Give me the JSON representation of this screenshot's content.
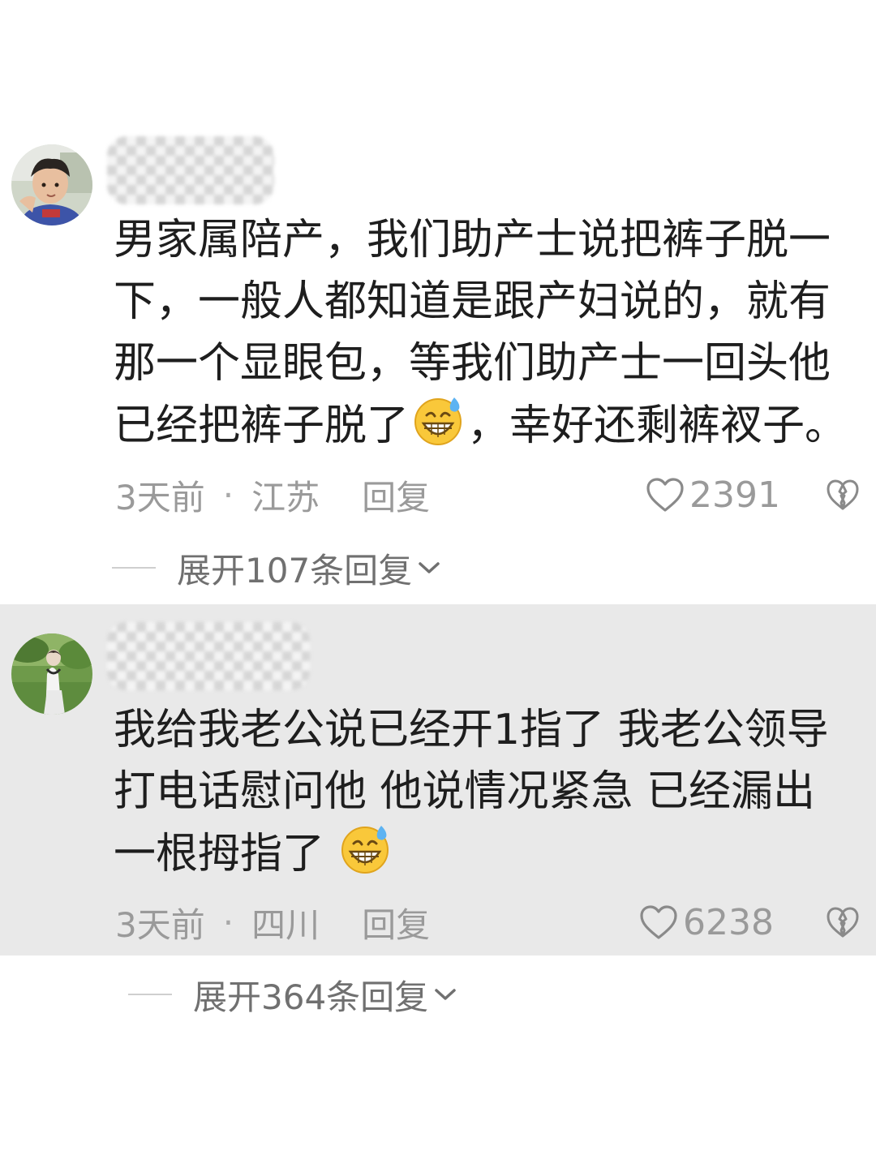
{
  "comments": [
    {
      "lines": [
        "男家属陪产，我们助产士说把裤子脱一",
        "下，一般人都知道是跟产妇说的，就有",
        "那一个显眼包，等我们助产士一回头他"
      ],
      "last_line_before_emoji": "已经把裤子脱了",
      "last_line_after_emoji": "，幸好还剩裤衩子。",
      "emoji_icon": "grinning-sweat-emoji",
      "time": "3天前",
      "separator": "·",
      "location": "江苏",
      "reply_label": "回复",
      "likes": "2391",
      "expand_label": "展开107条回复"
    },
    {
      "lines": [
        "我给我老公说已经开1指了 我老公领导",
        "打电话慰问他 他说情况紧急 已经漏出"
      ],
      "last_line_before_emoji": "一根拇指了",
      "last_line_after_emoji": "",
      "emoji_icon": "grinning-sweat-emoji",
      "time": "3天前",
      "separator": "·",
      "location": "四川",
      "reply_label": "回复",
      "likes": "6238",
      "expand_label": "展开364条回复"
    }
  ],
  "colors": {
    "highlight_background": "#e9e9e9",
    "meta_text": "#9a9a9a",
    "body_text": "#1e1e1e"
  }
}
